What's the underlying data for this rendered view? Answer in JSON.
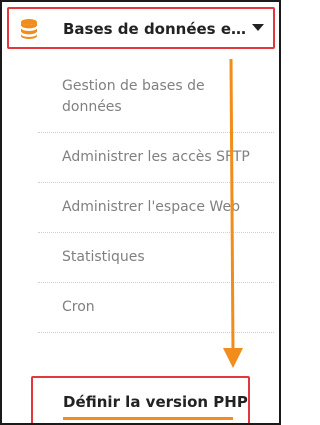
{
  "header": {
    "title": "Bases de données et e...",
    "icon": "database-icon"
  },
  "submenu": {
    "items": [
      {
        "label": "Gestion de bases de données"
      },
      {
        "label": "Administrer les accès SFTP"
      },
      {
        "label": "Administrer l'espace Web"
      },
      {
        "label": "Statistiques"
      },
      {
        "label": "Cron"
      }
    ],
    "active_label": "Définir la version PHP"
  },
  "colors": {
    "accent_orange": "#f28c1b",
    "highlight_red": "#e0383b"
  }
}
